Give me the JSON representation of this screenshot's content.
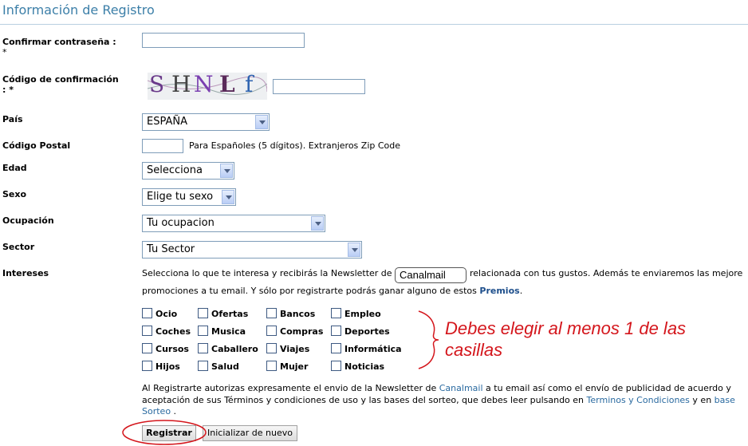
{
  "header": {
    "title": "Información de Registro"
  },
  "form": {
    "confirm_password_label": "Confirmar contraseña :",
    "confirm_password_req": "*",
    "confirmation_code_label": "Código de confirmación",
    "confirmation_code_req": ": *",
    "captcha_text": "SHNLf",
    "country_label": "País",
    "country_value": "ESPAÑA",
    "postal_label": "Código Postal",
    "postal_hint": "Para Españoles (5 dígitos). Extranjeros Zip Code",
    "age_label": "Edad",
    "age_value": "Selecciona",
    "sex_label": "Sexo",
    "sex_value": "Elige tu sexo",
    "occupation_label": "Ocupación",
    "occupation_value": "Tu ocupacion",
    "sector_label": "Sector",
    "sector_value": "Tu Sector",
    "interests_label": "Intereses",
    "interests_text_1": "Selecciona lo que te interesa y recibirás la Newsletter de",
    "logo_text": "Canalmail",
    "interests_text_2": "relacionada con tus gustos. Además te enviaremos las mejore",
    "interests_text_3": "promociones a tu email. Y sólo por registrarte podrás ganar alguno de estos",
    "prizes_link": "Premios",
    "interests_text_4": ".",
    "checkboxes": [
      [
        "Ocio",
        "Ofertas",
        "Bancos",
        "Empleo"
      ],
      [
        "Coches",
        "Musica",
        "Compras",
        "Deportes"
      ],
      [
        "Cursos",
        "Caballero",
        "Viajes",
        "Informática"
      ],
      [
        "Hijos",
        "Salud",
        "Mujer",
        "Noticias"
      ]
    ],
    "annotation_line1": "Debes elegir al menos 1 de las",
    "annotation_line2": "casillas",
    "legal_1a": "Al Registrarte autorizas expresamente el envio de la Newsletter de",
    "legal_1_link": "Canalmail",
    "legal_1b": "a tu email así como el envío de publicidad de acuerdo y",
    "legal_2a": "aceptación de sus Términos y condiciones de uso y las bases del sorteo, que debes leer pulsando en",
    "legal_2_link1": "Terminos y Condiciones",
    "legal_2b": "y en",
    "legal_2_link2": "base",
    "legal_3_link": "Sorteo",
    "legal_3b": ".",
    "register_button": "Registrar",
    "reset_button": "Inicializar de nuevo"
  },
  "colors": {
    "accent": "#3c7fa8",
    "annotation": "#d4161c"
  }
}
